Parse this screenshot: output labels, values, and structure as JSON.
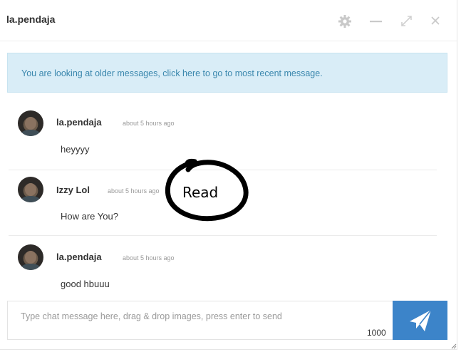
{
  "window": {
    "title": "la.pendaja",
    "icons": [
      "gear-icon",
      "minimize-icon",
      "expand-icon",
      "close-icon"
    ]
  },
  "alert": {
    "text": "You are looking at older messages, click here to go to most recent message."
  },
  "messages": [
    {
      "author": "la.pendaja",
      "time": "about 5 hours ago",
      "body": "heyyyy",
      "avatar": "avatar-photo"
    },
    {
      "author": "Izzy Lol",
      "time": "about 5 hours ago",
      "body": "How are You?",
      "avatar": "avatar-photo"
    },
    {
      "author": "la.pendaja",
      "time": "about 5 hours ago",
      "body": "good hbuuu",
      "avatar": "avatar-photo"
    }
  ],
  "annotation": {
    "text": "Read"
  },
  "composer": {
    "placeholder": "Type chat message here, drag & drop images, press enter to send",
    "counter": "1000",
    "send_icon": "paper-plane-icon"
  },
  "colors": {
    "alert_bg": "#d9edf7",
    "alert_text": "#3a87ad",
    "send_button": "#3c84c9"
  }
}
